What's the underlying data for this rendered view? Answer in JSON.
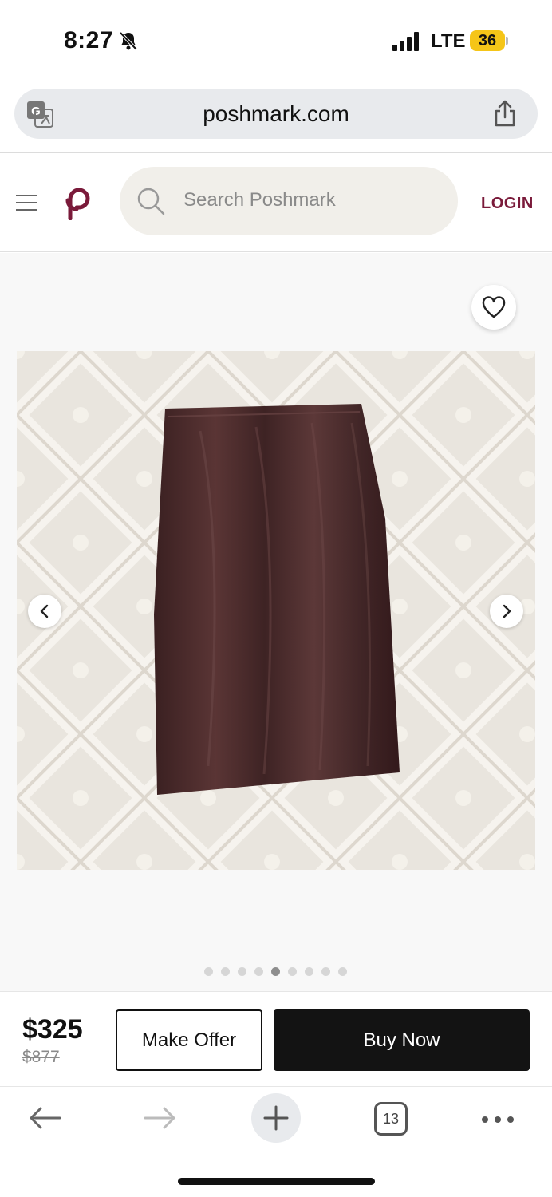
{
  "status_bar": {
    "time": "8:27",
    "network": "LTE",
    "battery": "36"
  },
  "browser": {
    "url": "poshmark.com",
    "tab_count": "13"
  },
  "header": {
    "search_placeholder": "Search Poshmark",
    "login_label": "LOGIN"
  },
  "carousel": {
    "image_count": 9,
    "active_index": 4
  },
  "listing": {
    "price": "$325",
    "original_price": "$877",
    "make_offer_label": "Make Offer",
    "buy_now_label": "Buy Now"
  },
  "colors": {
    "brand": "#7a1a3a",
    "buy_button": "#131313",
    "battery": "#f5c518"
  }
}
